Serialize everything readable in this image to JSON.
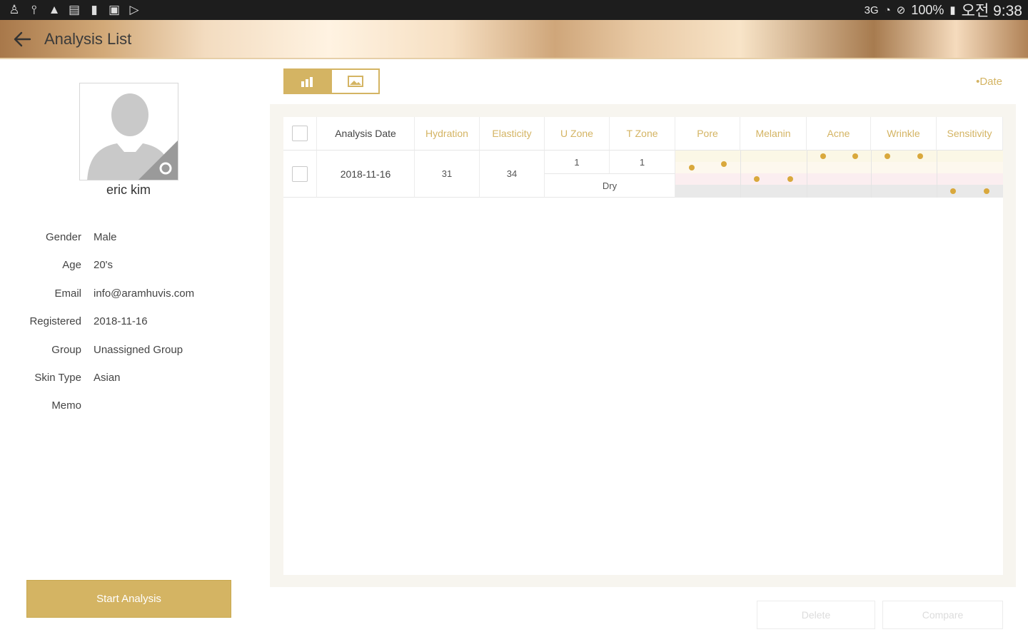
{
  "status_bar": {
    "left_icons": [
      "figure-icon",
      "usb-icon",
      "warning-icon",
      "gallery-icon",
      "sd-card-icon",
      "screenshot-icon",
      "play-store-icon"
    ],
    "network": "3G",
    "battery": "100%",
    "time": "오전 9:38"
  },
  "header": {
    "title": "Analysis List"
  },
  "profile": {
    "name": "eric kim",
    "fields": [
      {
        "label": "Gender",
        "value": "Male"
      },
      {
        "label": "Age",
        "value": "20's"
      },
      {
        "label": "Email",
        "value": "info@aramhuvis.com"
      },
      {
        "label": "Registered",
        "value": "2018-11-16"
      },
      {
        "label": "Group",
        "value": "Unassigned Group"
      },
      {
        "label": "Skin Type",
        "value": "Asian"
      },
      {
        "label": "Memo",
        "value": ""
      }
    ],
    "start_button": "Start Analysis"
  },
  "toolbar": {
    "sort_label": "•Date"
  },
  "table": {
    "headers": {
      "date": "Analysis Date",
      "hydration": "Hydration",
      "elasticity": "Elasticity",
      "u_zone": "U Zone",
      "t_zone": "T Zone",
      "pore": "Pore",
      "melanin": "Melanin",
      "acne": "Acne",
      "wrinkle": "Wrinkle",
      "sensitivity": "Sensitivity"
    },
    "rows": [
      {
        "date": "2018-11-16",
        "hydration": "31",
        "elasticity": "34",
        "u_zone": "1",
        "t_zone": "1",
        "zone_type": "Dry",
        "levels": {
          "pore": 2,
          "melanin": 3,
          "acne": 1,
          "wrinkle": 1,
          "sensitivity": 4
        }
      }
    ]
  },
  "actions": {
    "delete": "Delete",
    "compare": "Compare"
  },
  "colors": {
    "accent": "#d4b463",
    "dot": "#d9a83c"
  }
}
